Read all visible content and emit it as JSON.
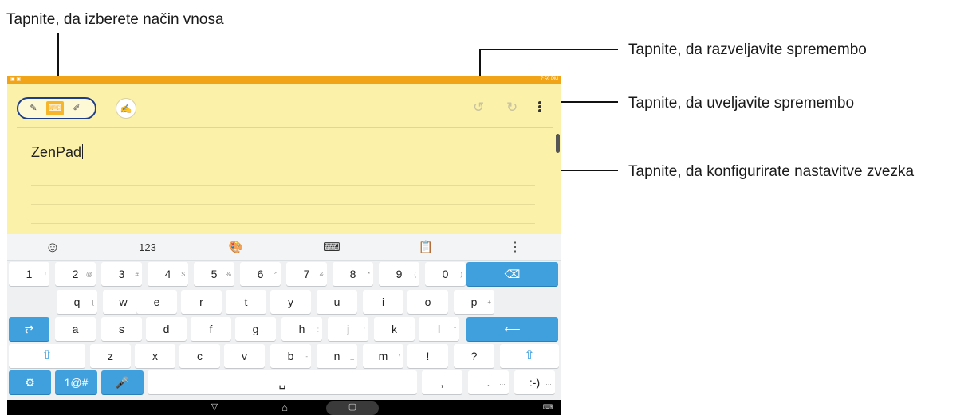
{
  "callouts": {
    "input_mode": "Tapnite, da izberete način vnosa",
    "undo": "Tapnite, da razveljavite spremembo",
    "redo": "Tapnite, da uveljavite spremembo",
    "settings": "Tapnite, da konfigurirate nastavitve zvezka"
  },
  "status_bar": {
    "time": "7:59 PM"
  },
  "note": {
    "text": "ZenPad"
  },
  "icons": {
    "handwriting": "handwriting-icon",
    "keyboard": "keyboard-icon",
    "stylus": "stylus-icon",
    "pen": "pen-icon",
    "undo": "undo-icon",
    "redo": "redo-icon",
    "menu": "more-vert-icon"
  },
  "suggestion_bar": {
    "emoji": "☺",
    "numbers": "123",
    "theme": "🎨",
    "keyboard": "⌨",
    "clipboard": "📋",
    "more": "⋮"
  },
  "keyboard": {
    "row1": [
      {
        "label": "1",
        "hint": "!"
      },
      {
        "label": "2",
        "hint": "@"
      },
      {
        "label": "3",
        "hint": "#"
      },
      {
        "label": "4",
        "hint": "$"
      },
      {
        "label": "5",
        "hint": "%"
      },
      {
        "label": "6",
        "hint": "^"
      },
      {
        "label": "7",
        "hint": "&"
      },
      {
        "label": "8",
        "hint": "*"
      },
      {
        "label": "9",
        "hint": "("
      },
      {
        "label": "0",
        "hint": ")"
      },
      {
        "label": "⌫",
        "hint": ""
      }
    ],
    "row2": [
      {
        "label": "q",
        "hint": "["
      },
      {
        "label": "w",
        "hint": "]"
      },
      {
        "label": "e",
        "hint": ""
      },
      {
        "label": "r",
        "hint": ""
      },
      {
        "label": "t",
        "hint": ""
      },
      {
        "label": "y",
        "hint": ""
      },
      {
        "label": "u",
        "hint": ""
      },
      {
        "label": "i",
        "hint": ""
      },
      {
        "label": "o",
        "hint": ""
      },
      {
        "label": "p",
        "hint": "+"
      }
    ],
    "row3": [
      {
        "label": "⇄",
        "hint": ""
      },
      {
        "label": "a",
        "hint": ""
      },
      {
        "label": "s",
        "hint": ""
      },
      {
        "label": "d",
        "hint": ""
      },
      {
        "label": "f",
        "hint": ""
      },
      {
        "label": "g",
        "hint": ""
      },
      {
        "label": "h",
        "hint": ";"
      },
      {
        "label": "j",
        "hint": ":"
      },
      {
        "label": "k",
        "hint": "'"
      },
      {
        "label": "l",
        "hint": "\""
      },
      {
        "label": "⟵",
        "hint": ""
      }
    ],
    "row4": [
      {
        "label": "⇧",
        "hint": ""
      },
      {
        "label": "z",
        "hint": ""
      },
      {
        "label": "x",
        "hint": ""
      },
      {
        "label": "c",
        "hint": ""
      },
      {
        "label": "v",
        "hint": ""
      },
      {
        "label": "b",
        "hint": "-"
      },
      {
        "label": "n",
        "hint": "_"
      },
      {
        "label": "m",
        "hint": "/"
      },
      {
        "label": "!",
        "hint": ""
      },
      {
        "label": "?",
        "hint": ""
      },
      {
        "label": "⇧",
        "hint": ""
      }
    ],
    "row5": [
      {
        "label": "⚙",
        "hint": ""
      },
      {
        "label": "1@#",
        "hint": ""
      },
      {
        "label": "🎤",
        "hint": ""
      },
      {
        "label": "␣",
        "hint": ""
      },
      {
        "label": ",",
        "hint": ""
      },
      {
        "label": ".",
        "hint": "…"
      },
      {
        "label": ":-)",
        "hint": "…"
      }
    ]
  },
  "nav_bar": {
    "back": "▽",
    "home": "⌂",
    "recents": "▢",
    "keyboard": "⌨"
  },
  "colors": {
    "note_bg": "#fbf1a8",
    "status_bar": "#f2a418",
    "accent": "#3fa0dd",
    "callout_line": "#111111"
  }
}
